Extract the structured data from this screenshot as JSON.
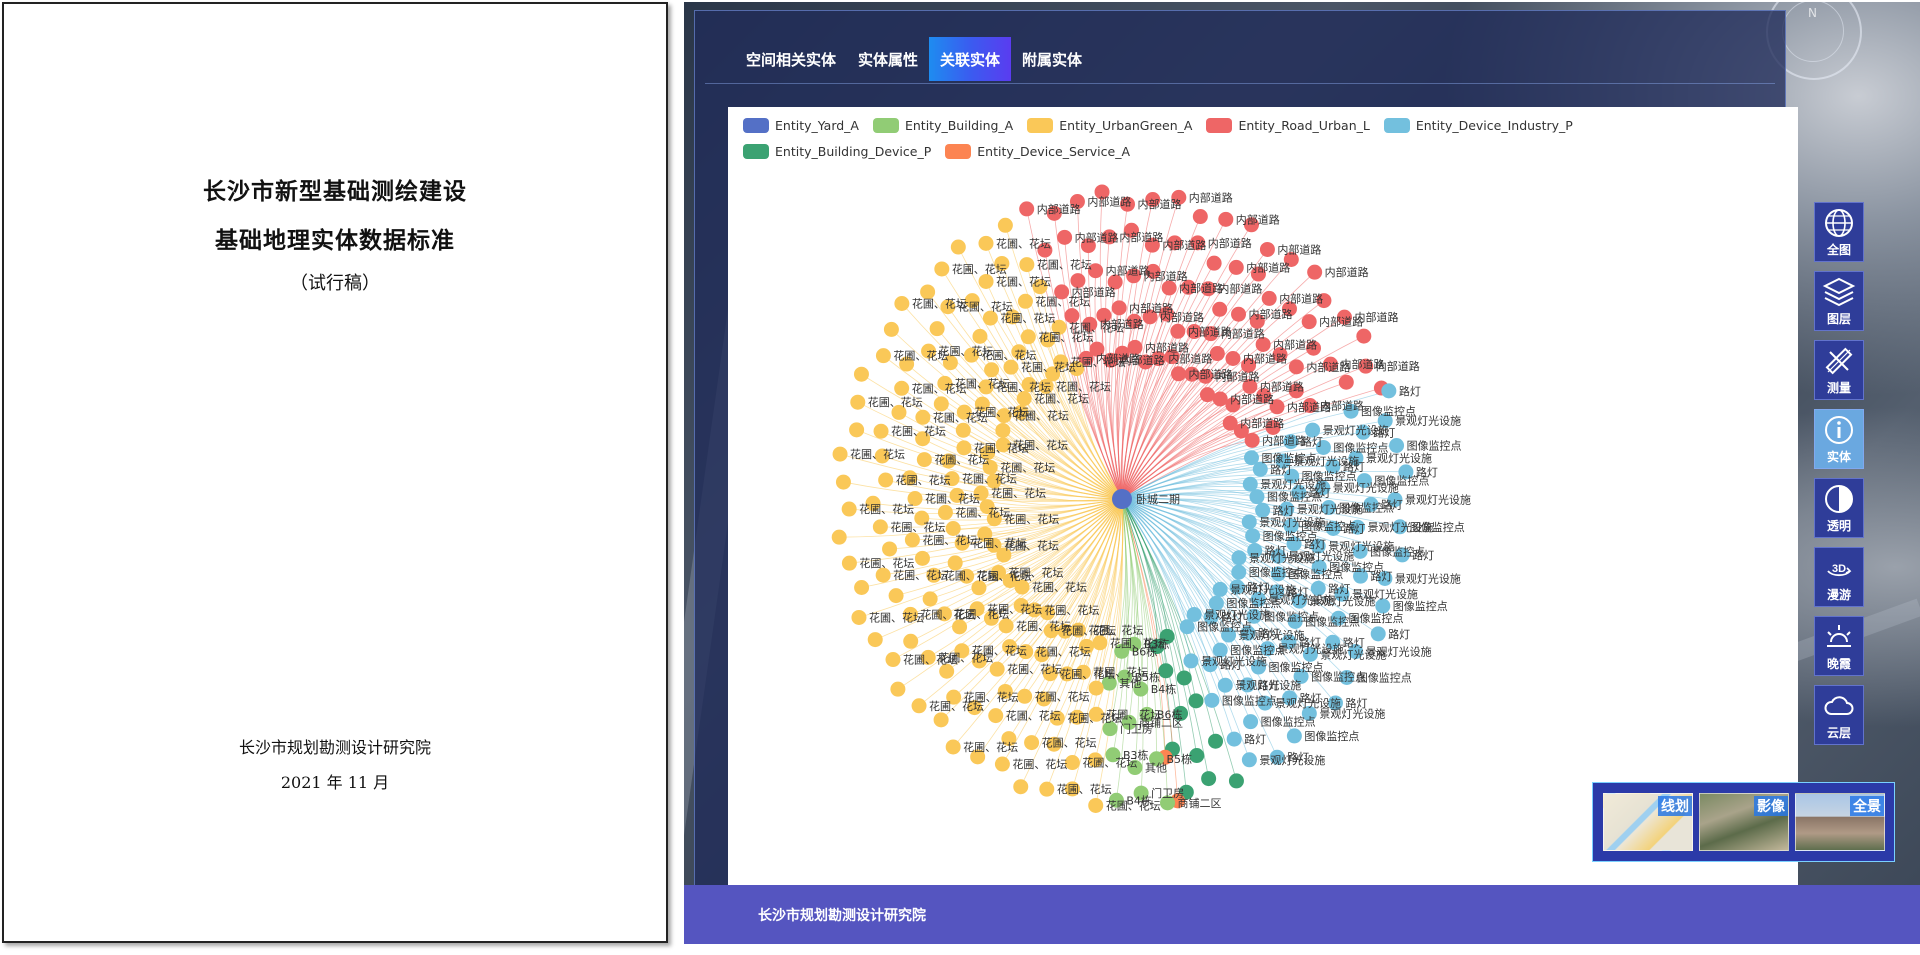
{
  "document": {
    "title_line1": "长沙市新型基础测绘建设",
    "title_line2": "基础地理实体数据标准",
    "subtitle": "（试行稿）",
    "organization": "长沙市规划勘测设计研究院",
    "date": "2021 年 11 月"
  },
  "tabs": [
    {
      "label": "空间相关实体",
      "active": false
    },
    {
      "label": "实体属性",
      "active": false
    },
    {
      "label": "关联实体",
      "active": true
    },
    {
      "label": "附属实体",
      "active": false
    }
  ],
  "legend": [
    {
      "label": "Entity_Yard_A",
      "color": "#5470c6"
    },
    {
      "label": "Entity_Building_A",
      "color": "#91cc75"
    },
    {
      "label": "Entity_UrbanGreen_A",
      "color": "#fac858"
    },
    {
      "label": "Entity_Road_Urban_L",
      "color": "#ee6666"
    },
    {
      "label": "Entity_Device_Industry_P",
      "color": "#73c0de"
    },
    {
      "label": "Entity_Building_Device_P",
      "color": "#3ba272"
    },
    {
      "label": "Entity_Device_Service_A",
      "color": "#fc8452"
    }
  ],
  "graph": {
    "center_label": "卧城二期",
    "groups": [
      {
        "category": "Entity_Road_Urban_L",
        "color": "#ee6666",
        "count": 86,
        "labels": [
          "内部道路"
        ]
      },
      {
        "category": "Entity_Device_Industry_P",
        "color": "#73c0de",
        "count": 84,
        "labels": [
          "路灯",
          "图像监控点",
          "景观灯光设施"
        ]
      },
      {
        "category": "Entity_Building_Device_P",
        "color": "#3ba272",
        "count": 12,
        "labels": []
      },
      {
        "category": "Entity_Device_Service_A",
        "color": "#fc8452",
        "count": 2,
        "labels": []
      },
      {
        "category": "Entity_Building_A",
        "color": "#91cc75",
        "count": 14,
        "labels": [
          "商铺二区",
          "B5栋",
          "B6栋",
          "B4栋",
          "B3栋",
          "门卫房",
          "其他"
        ]
      },
      {
        "category": "Entity_UrbanGreen_A",
        "color": "#fac858",
        "count": 150,
        "labels": [
          "花圃、花坛"
        ]
      }
    ]
  },
  "footer_text": "长沙市规划勘测设计研究院",
  "toolbar": [
    {
      "label": "全图",
      "icon": "globe-icon",
      "active": false
    },
    {
      "label": "图层",
      "icon": "layers-icon",
      "active": false
    },
    {
      "label": "测量",
      "icon": "ruler-icon",
      "active": false
    },
    {
      "label": "实体",
      "icon": "info-icon",
      "active": true
    },
    {
      "label": "透明",
      "icon": "half-circle-icon",
      "active": false
    },
    {
      "label": "漫游",
      "icon": "3d-rotate-icon",
      "active": false
    },
    {
      "label": "晚霞",
      "icon": "sunset-icon",
      "active": false
    },
    {
      "label": "云层",
      "icon": "cloud-icon",
      "active": false
    }
  ],
  "basemaps": [
    {
      "label": "线划",
      "thumb": "map-vector-thumb"
    },
    {
      "label": "影像",
      "thumb": "map-imagery-thumb"
    },
    {
      "label": "全景",
      "thumb": "map-panorama-thumb"
    }
  ]
}
